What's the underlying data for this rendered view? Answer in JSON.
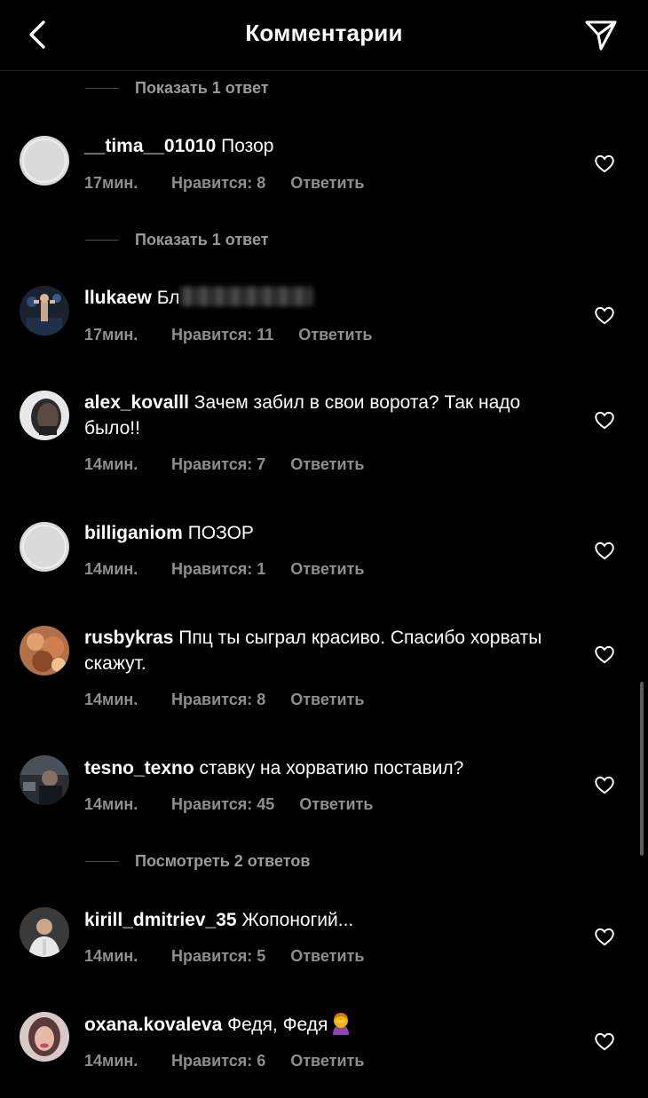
{
  "header": {
    "title": "Комментарии"
  },
  "colors": {
    "background": "#000000",
    "text": "#ffffff",
    "meta": "#8e8e8e"
  },
  "replies": [
    {
      "label": "Показать 1 ответ"
    },
    {
      "label": "Показать 1 ответ"
    },
    {
      "label": "Посмотреть 2 ответов"
    }
  ],
  "comments": [
    {
      "user": "__tima__01010",
      "text": "Позор",
      "time": "17мин.",
      "likes": "Нравится: 8",
      "reply": "Ответить",
      "avatar": "placeholder"
    },
    {
      "user": "llukaew",
      "text": "Бл",
      "time": "17мин.",
      "likes": "Нравится: 11",
      "reply": "Ответить",
      "avatar": "photo",
      "text_blurred": true
    },
    {
      "user": "alex_kovalll",
      "text": "Зачем забил в свои ворота? Так надо было!!",
      "time": "14мин.",
      "likes": "Нравится: 7",
      "reply": "Ответить",
      "avatar": "photo"
    },
    {
      "user": "billiganiom",
      "text": "ПОЗОР",
      "time": "14мин.",
      "likes": "Нравится: 1",
      "reply": "Ответить",
      "avatar": "placeholder"
    },
    {
      "user": "rusbykras",
      "text": "Ппц ты сыграл красиво. Спасибо хорваты  скажут.",
      "time": "14мин.",
      "likes": "Нравится: 8",
      "reply": "Ответить",
      "avatar": "photo"
    },
    {
      "user": "tesno_texno",
      "text": "ставку на хорватию поставил?",
      "time": "14мин.",
      "likes": "Нравится: 45",
      "reply": "Ответить",
      "avatar": "photo"
    },
    {
      "user": "kirill_dmitriev_35",
      "text": "Жопоногий...",
      "time": "14мин.",
      "likes": "Нравится: 5",
      "reply": "Ответить",
      "avatar": "photo"
    },
    {
      "user": "oxana.kovaleva",
      "text": "Федя, Федя",
      "time": "14мин.",
      "likes": "Нравится: 6",
      "reply": "Ответить",
      "avatar": "photo",
      "emoji": "facepalm-woman-emoji"
    }
  ]
}
